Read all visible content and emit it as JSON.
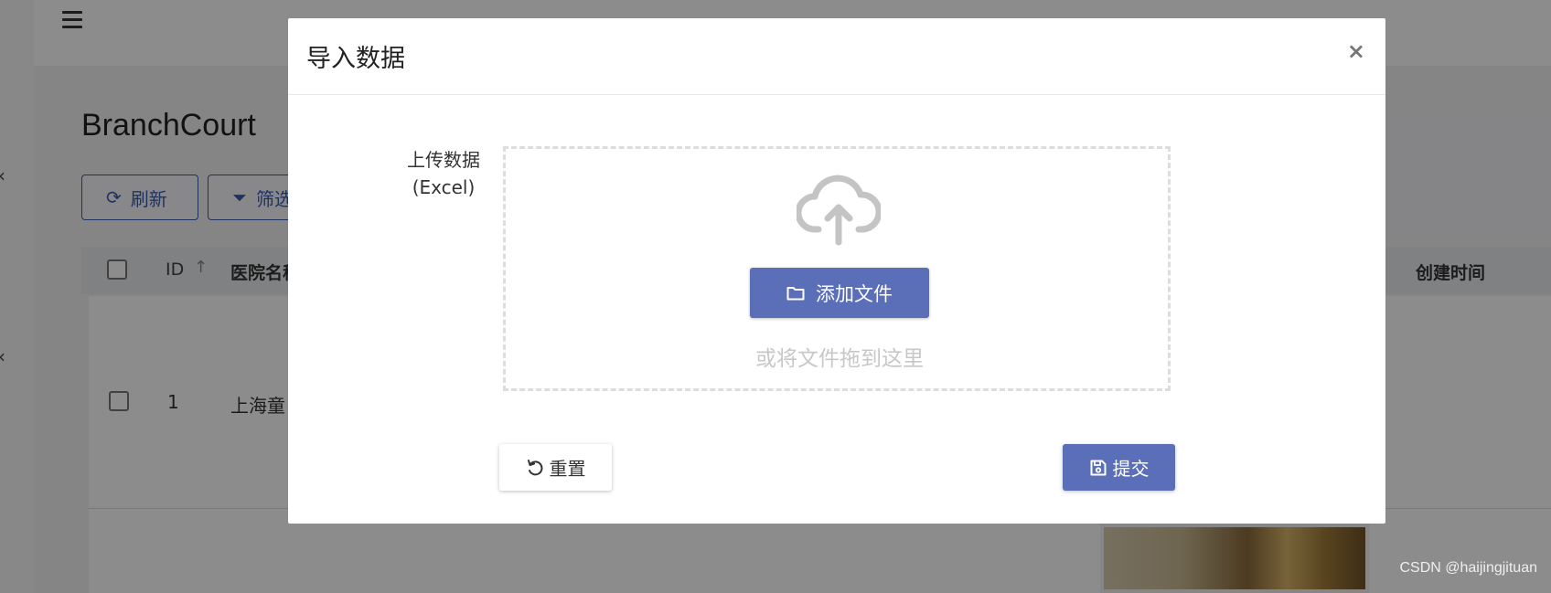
{
  "background": {
    "title": "BranchCourt",
    "toolbar": {
      "refresh_label": "刷新",
      "filter_label": "筛选"
    },
    "table": {
      "headers": {
        "id": "ID",
        "hospital_name": "医院名称",
        "created_at": "创建时间"
      },
      "rows": [
        {
          "id": "1",
          "hospital_name": "上海童"
        }
      ]
    }
  },
  "modal": {
    "title": "导入数据",
    "close_symbol": "×",
    "upload_label_line1": "上传数据",
    "upload_label_line2": "(Excel)",
    "add_file_label": "添加文件",
    "drop_hint": "或将文件拖到这里",
    "reset_label": "重置",
    "submit_label": "提交"
  },
  "watermark": "CSDN @haijingjituan",
  "colors": {
    "primary": "#5b6fb8",
    "link": "#3b5bb0",
    "overlay": "rgba(0,0,0,0.45)"
  }
}
